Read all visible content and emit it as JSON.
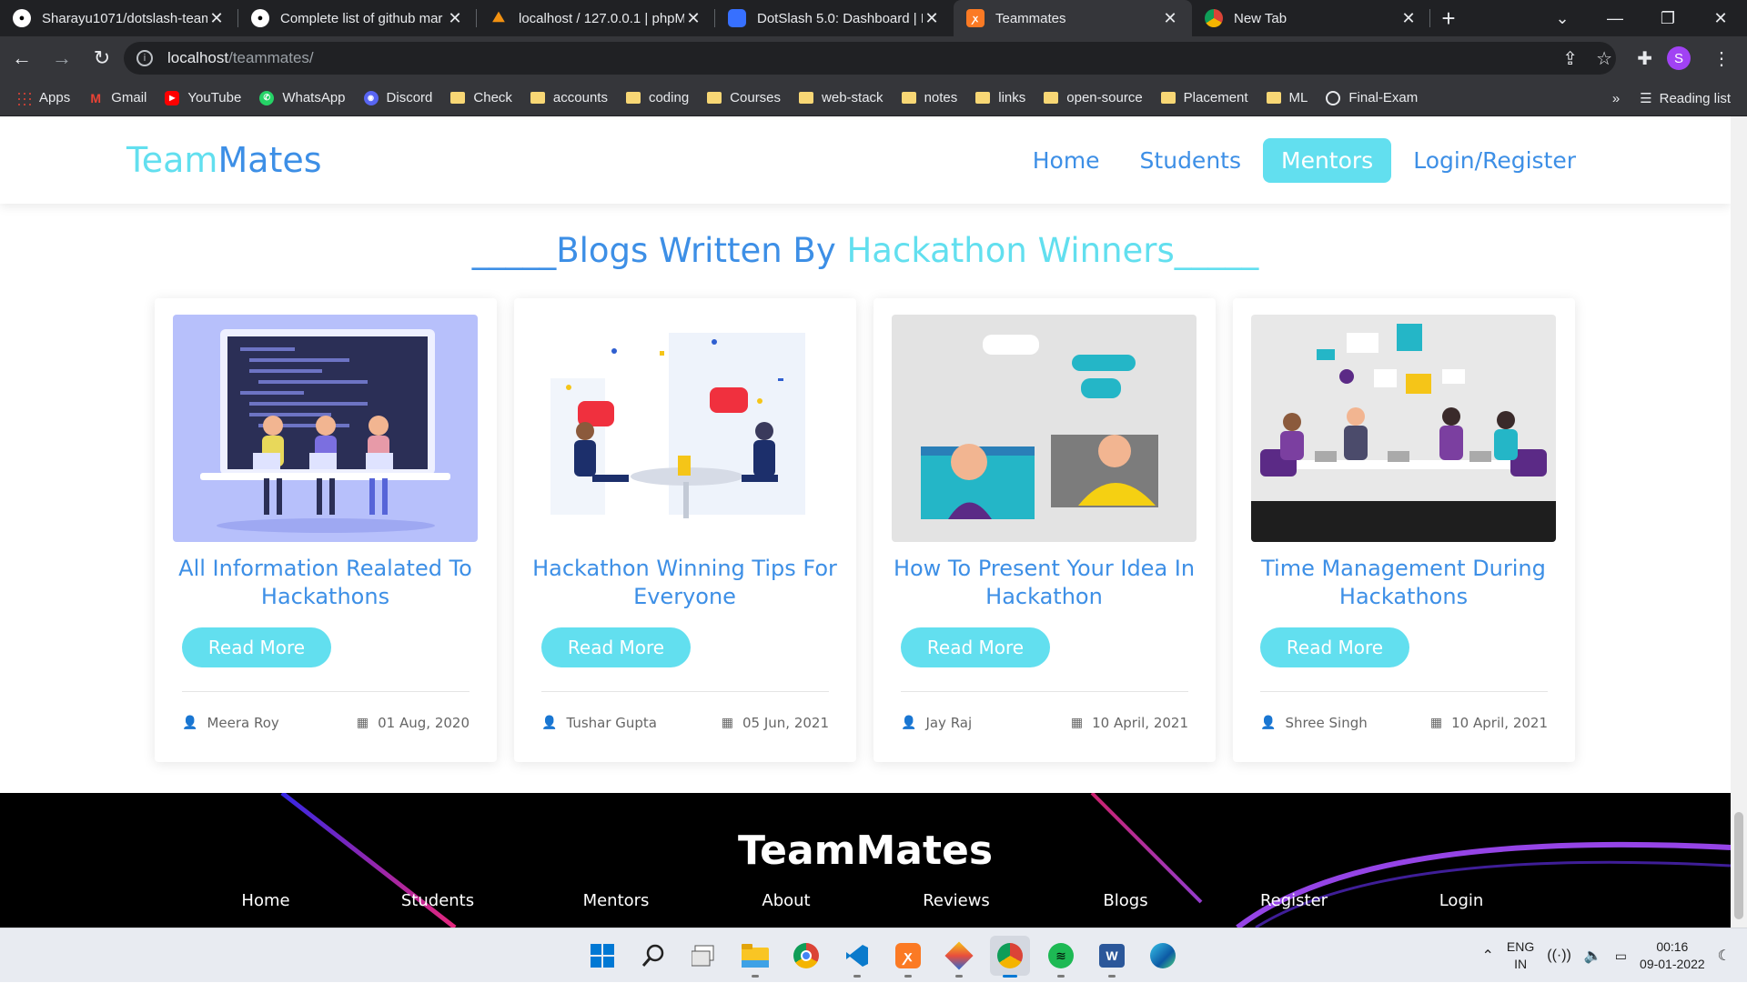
{
  "browser": {
    "tabs": [
      {
        "title": "Sharayu1071/dotslash-team",
        "icon": "github-icon"
      },
      {
        "title": "Complete list of github mar",
        "icon": "github-icon"
      },
      {
        "title": "localhost / 127.0.0.1 | phpM",
        "icon": "phpmyadmin-icon"
      },
      {
        "title": "DotSlash 5.0: Dashboard | D",
        "icon": "devfolio-icon"
      },
      {
        "title": "Teammates",
        "icon": "xampp-icon"
      },
      {
        "title": "New Tab",
        "icon": "chrome-icon"
      }
    ],
    "address": {
      "host": "localhost",
      "path": "/teammates/"
    },
    "profile_initial": "S",
    "bookmarks": [
      {
        "label": "Apps",
        "icon": "apps-grid-icon"
      },
      {
        "label": "Gmail",
        "icon": "gmail-icon"
      },
      {
        "label": "YouTube",
        "icon": "youtube-icon"
      },
      {
        "label": "WhatsApp",
        "icon": "whatsapp-icon"
      },
      {
        "label": "Discord",
        "icon": "discord-icon"
      },
      {
        "label": "Check",
        "icon": "folder-icon"
      },
      {
        "label": "accounts",
        "icon": "folder-icon"
      },
      {
        "label": "coding",
        "icon": "folder-icon"
      },
      {
        "label": "Courses",
        "icon": "folder-icon"
      },
      {
        "label": "web-stack",
        "icon": "folder-icon"
      },
      {
        "label": "notes",
        "icon": "folder-icon"
      },
      {
        "label": "links",
        "icon": "folder-icon"
      },
      {
        "label": "open-source",
        "icon": "folder-icon"
      },
      {
        "label": "Placement",
        "icon": "folder-icon"
      },
      {
        "label": "ML",
        "icon": "folder-icon"
      },
      {
        "label": "Final-Exam",
        "icon": "globe-icon"
      }
    ],
    "overflow": "»",
    "reading_list": "Reading list"
  },
  "site": {
    "logo_a": "Team",
    "logo_b": "Mates",
    "nav": [
      "Home",
      "Students",
      "Mentors",
      "Login/Register"
    ],
    "active_nav": "Mentors",
    "section_title_a": "_____Blogs Written By ",
    "section_title_b": "Hackathon Winners_____",
    "cards": [
      {
        "title": "All Information Realated To Hackathons",
        "button": "Read More",
        "author": "Meera Roy",
        "date": "01 Aug, 2020"
      },
      {
        "title": "Hackathon Winning Tips For Everyone",
        "button": "Read More",
        "author": "Tushar Gupta",
        "date": "05 Jun, 2021"
      },
      {
        "title": "How To Present Your Idea In Hackathon",
        "button": "Read More",
        "author": "Jay Raj",
        "date": "10 April, 2021"
      },
      {
        "title": "Time Management During Hackathons",
        "button": "Read More",
        "author": "Shree Singh",
        "date": "10 April, 2021"
      }
    ],
    "footer": {
      "brand": "TeamMates",
      "links": [
        "Home",
        "Students",
        "Mentors",
        "About",
        "Reviews",
        "Blogs",
        "Register",
        "Login"
      ]
    }
  },
  "taskbar": {
    "apps": [
      "windows-start-icon",
      "search-icon",
      "task-view-icon",
      "file-explorer-icon",
      "chrome-icon",
      "vscode-icon",
      "xampp-icon",
      "git-icon",
      "chrome-profile-icon",
      "spotify-icon",
      "word-icon",
      "edge-icon"
    ],
    "lang_1": "ENG",
    "lang_2": "IN",
    "time": "00:16",
    "date": "09-01-2022"
  },
  "colors": {
    "accent": "#62dfef",
    "primary": "#3d8fe6",
    "chrome_dark": "#202124"
  }
}
